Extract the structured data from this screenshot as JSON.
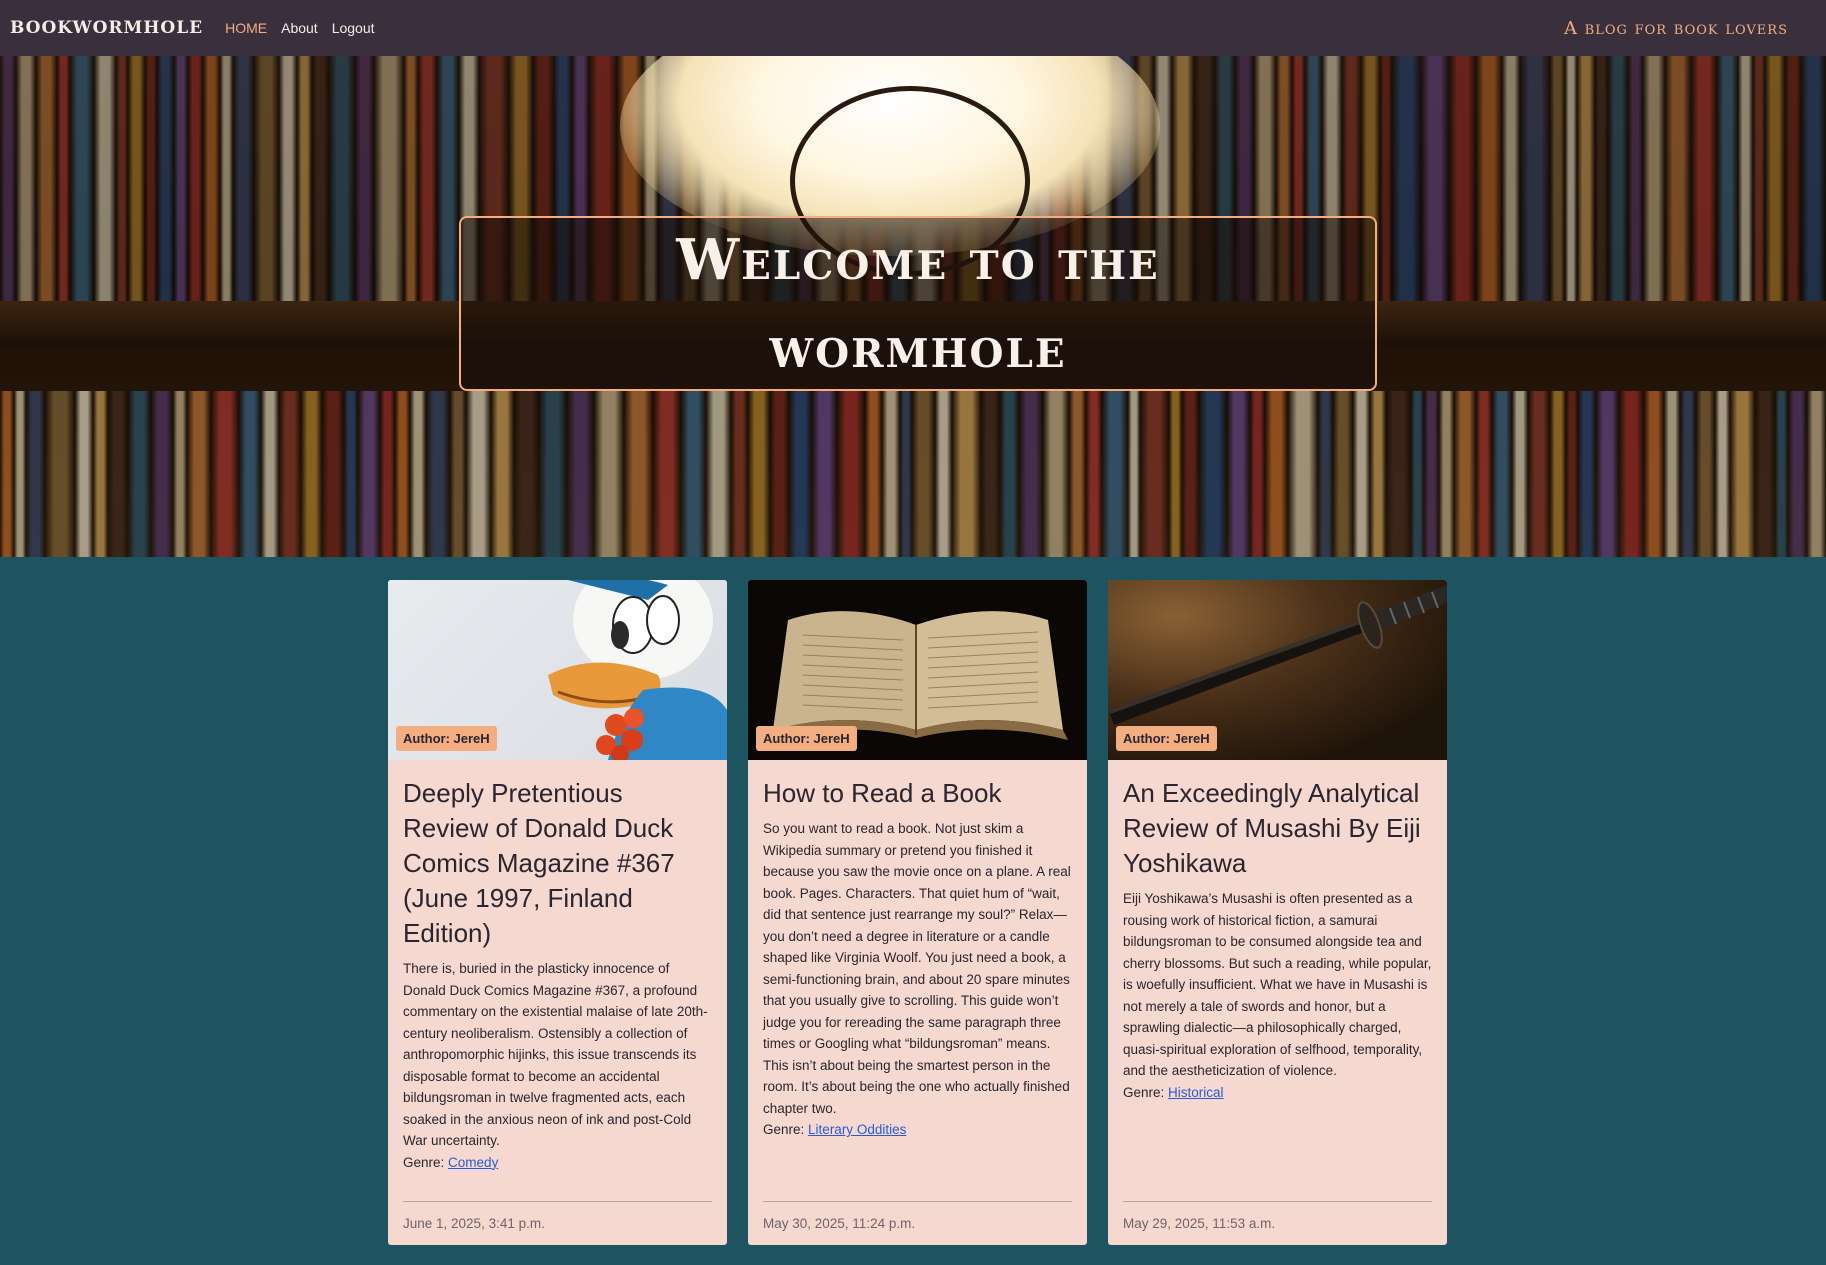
{
  "nav": {
    "brand": "BookWormhole",
    "links": [
      "HOME",
      "About",
      "Logout"
    ],
    "tagline": "A blog for book lovers"
  },
  "hero": {
    "title": "Welcome to the wormhole"
  },
  "posts": [
    {
      "image": "donald-duck-figure",
      "author": "Author: JereH",
      "title": "Deeply Pretentious Review of Donald Duck Comics Magazine #367 (June 1997, Finland Edition)",
      "excerpt": "There is, buried in the plasticky innocence of Donald Duck Comics Magazine #367, a profound commentary on the existential malaise of late 20th-century neoliberalism. Ostensibly a collection of anthropomorphic hijinks, this issue transcends its disposable format to become an accidental bildungsroman in twelve fragmented acts, each soaked in the anxious neon of ink and post-Cold War uncertainty.",
      "genre_label": "Genre:",
      "genre": "Comedy",
      "date": "June 1, 2025, 3:41 p.m."
    },
    {
      "image": "open-book",
      "author": "Author: JereH",
      "title": "How to Read a Book",
      "excerpt": "So you want to read a book. Not just skim a Wikipedia summary or pretend you finished it because you saw the movie once on a plane. A real book. Pages. Characters. That quiet hum of “wait, did that sentence just rearrange my soul?” Relax—you don’t need a degree in literature or a candle shaped like Virginia Woolf. You just need a book, a semi-functioning brain, and about 20 spare minutes that you usually give to scrolling. This guide won’t judge you for rereading the same paragraph three times or Googling what “bildungsroman” means. This isn’t about being the smartest person in the room. It’s about being the one who actually finished chapter two.",
      "genre_label": "Genre:",
      "genre": "Literary Oddities",
      "date": "May 30, 2025, 11:24 p.m."
    },
    {
      "image": "katana",
      "author": "Author: JereH",
      "title": "An Exceedingly Analytical Review of Musashi By Eiji Yoshikawa",
      "excerpt": "Eiji Yoshikawa’s Musashi is often presented as a rousing work of historical fiction, a samurai bildungsroman to be consumed alongside tea and cherry blossoms. But such a reading, while popular, is woefully insufficient. What we have in Musashi is not merely a tale of swords and honor, but a sprawling dialectic—a philosophically charged, quasi-spiritual exploration of selfhood, temporality, and the aestheticization of violence.",
      "genre_label": "Genre:",
      "genre": "Historical",
      "date": "May 29, 2025, 11:53 a.m."
    }
  ]
}
